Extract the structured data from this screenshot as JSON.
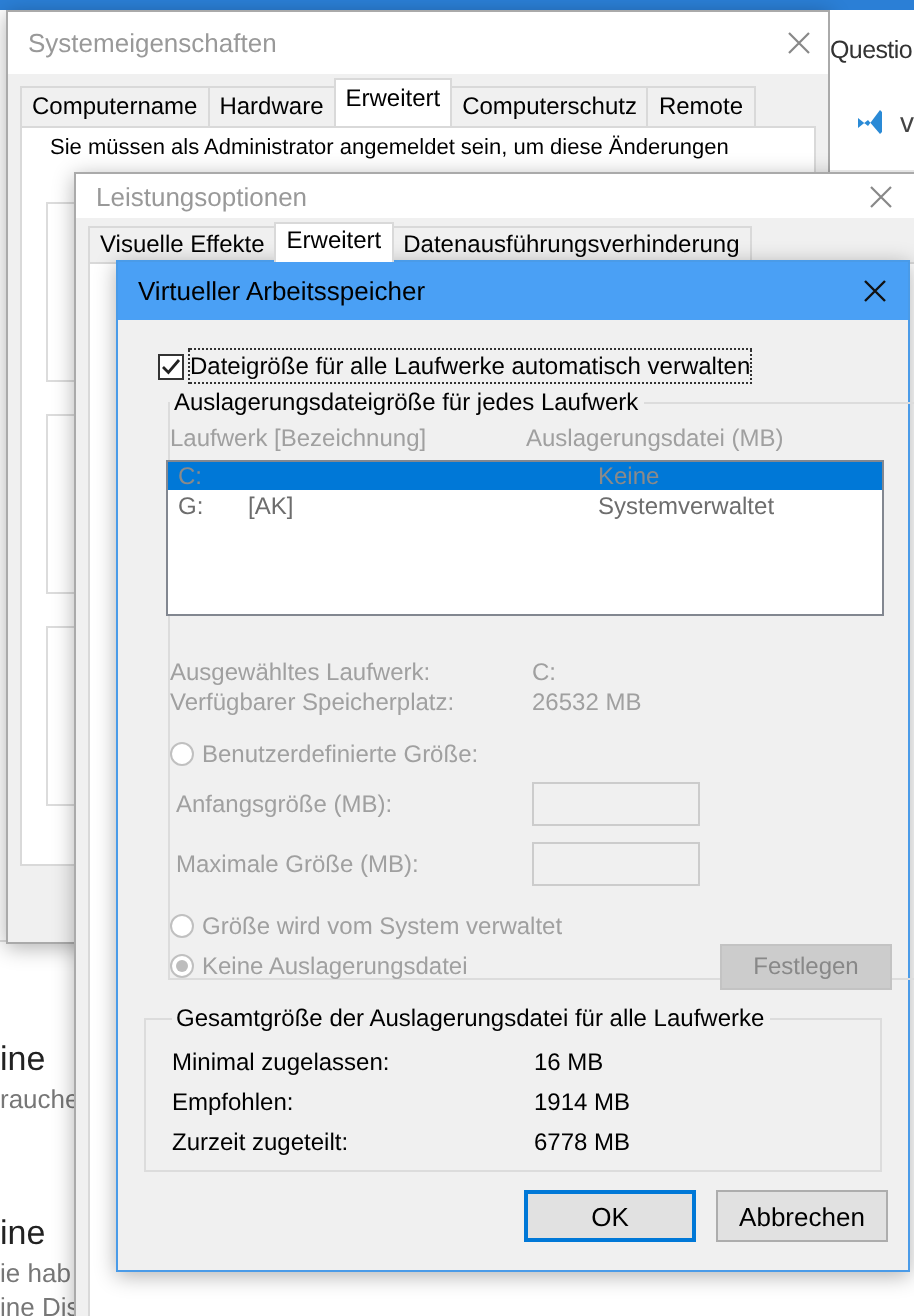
{
  "background_page": {
    "heading": "Questio",
    "link_letter": "v",
    "snippets": [
      {
        "kind": "title",
        "text": "ine"
      },
      {
        "kind": "body",
        "text": "rauche"
      },
      {
        "kind": "title",
        "text": "ine"
      },
      {
        "kind": "body",
        "text": "ie hab"
      },
      {
        "kind": "body",
        "text": "ine Dis"
      }
    ]
  },
  "system_properties": {
    "title": "Systemeigenschaften",
    "tabs": [
      {
        "label": "Computername",
        "selected": false
      },
      {
        "label": "Hardware",
        "selected": false
      },
      {
        "label": "Erweitert",
        "selected": true
      },
      {
        "label": "Computerschutz",
        "selected": false
      },
      {
        "label": "Remote",
        "selected": false
      }
    ],
    "notice": [
      "Sie müssen als Administrator angemeldet sein, um diese Änderungen"
    ]
  },
  "performance_options": {
    "title": "Leistungsoptionen",
    "tabs": [
      {
        "label": "Visuelle Effekte",
        "selected": false
      },
      {
        "label": "Erweitert",
        "selected": true
      },
      {
        "label": "Datenausführungsverhinderung",
        "selected": false
      }
    ]
  },
  "virtual_memory": {
    "title": "Virtueller Arbeitsspeicher",
    "auto_manage": {
      "label": "Dateigröße für alle Laufwerke automatisch verwalten",
      "checked": true,
      "focused": true
    },
    "per_drive": {
      "title": "Auslagerungsdateigröße für jedes Laufwerk",
      "disabled": true,
      "columns": [
        "Laufwerk [Bezeichnung]",
        "Auslagerungsdatei (MB)"
      ],
      "drives": [
        {
          "drive": "C:",
          "paging": "Keine",
          "selected": true
        },
        {
          "drive": "G:",
          "label": "[AK]",
          "paging": "Systemverwaltet",
          "selected": false
        }
      ],
      "info": [
        {
          "label": "Ausgewähltes Laufwerk:",
          "value": "C:"
        },
        {
          "label": "Verfügbarer Speicherplatz:",
          "value": "26532 MB"
        }
      ],
      "options": [
        {
          "label": "Benutzerdefinierte Größe:",
          "selected": false
        },
        {
          "label": "Größe wird vom System verwaltet",
          "selected": false
        },
        {
          "label": "Keine Auslagerungsdatei",
          "selected": true
        }
      ],
      "fields": [
        {
          "label": "Anfangsgröße (MB):"
        },
        {
          "label": "Maximale Größe (MB):"
        }
      ],
      "set_button": "Festlegen"
    },
    "totals": {
      "title": "Gesamtgröße der Auslagerungsdatei für alle Laufwerke",
      "rows": [
        {
          "label": "Minimal zugelassen:",
          "value": "16 MB"
        },
        {
          "label": "Empfohlen:",
          "value": "1914 MB"
        },
        {
          "label": "Zurzeit zugeteilt:",
          "value": "6778 MB"
        }
      ]
    },
    "buttons": [
      {
        "label": "OK",
        "focused": true
      },
      {
        "label": "Abbrechen",
        "focused": false
      }
    ]
  }
}
